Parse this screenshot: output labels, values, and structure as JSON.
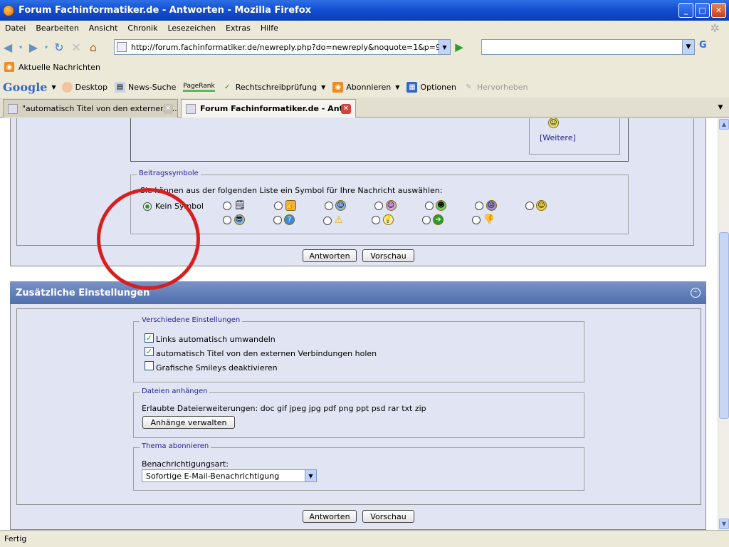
{
  "window": {
    "title": "Forum Fachinformatiker.de - Antworten - Mozilla Firefox",
    "min": "_",
    "max": "□",
    "close": "✕"
  },
  "menu": [
    "Datei",
    "Bearbeiten",
    "Ansicht",
    "Chronik",
    "Lesezeichen",
    "Extras",
    "Hilfe"
  ],
  "nav": {
    "url": "http://forum.fachinformatiker.de/newreply.php?do=newreply&noquote=1&p=94592",
    "search_value": ""
  },
  "bookmarks": {
    "item": "Aktuelle Nachrichten"
  },
  "google_toolbar": {
    "logo": "Google",
    "desktop": "Desktop",
    "news": "News-Suche",
    "pagerank": "PageRank",
    "spell": "Rechtschreibprüfung",
    "subscribe": "Abonnieren",
    "options": "Optionen",
    "highlight": "Hervorheben"
  },
  "tabs": [
    {
      "label": "\"automatisch Titel von den externen V..."
    },
    {
      "label": "Forum Fachinformatiker.de - Ant..."
    }
  ],
  "smilies_more": "[Weitere]",
  "post_icons": {
    "legend": "Beitragssymbole",
    "hint": "Sie können aus der folgenden Liste ein Symbol für Ihre Nachricht auswählen:",
    "none_label": "Kein Symbol"
  },
  "buttons": {
    "reply": "Antworten",
    "preview": "Vorschau"
  },
  "additional": {
    "title": "Zusätzliche Einstellungen",
    "misc": {
      "legend": "Verschiedene Einstellungen",
      "opt1": "Links automatisch umwandeln",
      "opt2": "automatisch Titel von den externen Verbindungen holen",
      "opt3": "Grafische Smileys deaktivieren",
      "opt1_checked": true,
      "opt2_checked": true,
      "opt3_checked": false
    },
    "attach": {
      "legend": "Dateien anhängen",
      "allowed": "Erlaubte Dateierweiterungen: doc gif jpeg jpg pdf png ppt psd rar txt zip",
      "button": "Anhänge verwalten"
    },
    "subscribe": {
      "legend": "Thema abonnieren",
      "label": "Benachrichtigungsart:",
      "selected": "Sofortige E-Mail-Benachrichtigung"
    }
  },
  "status": "Fertig",
  "annotation_color": "#D81F1F"
}
